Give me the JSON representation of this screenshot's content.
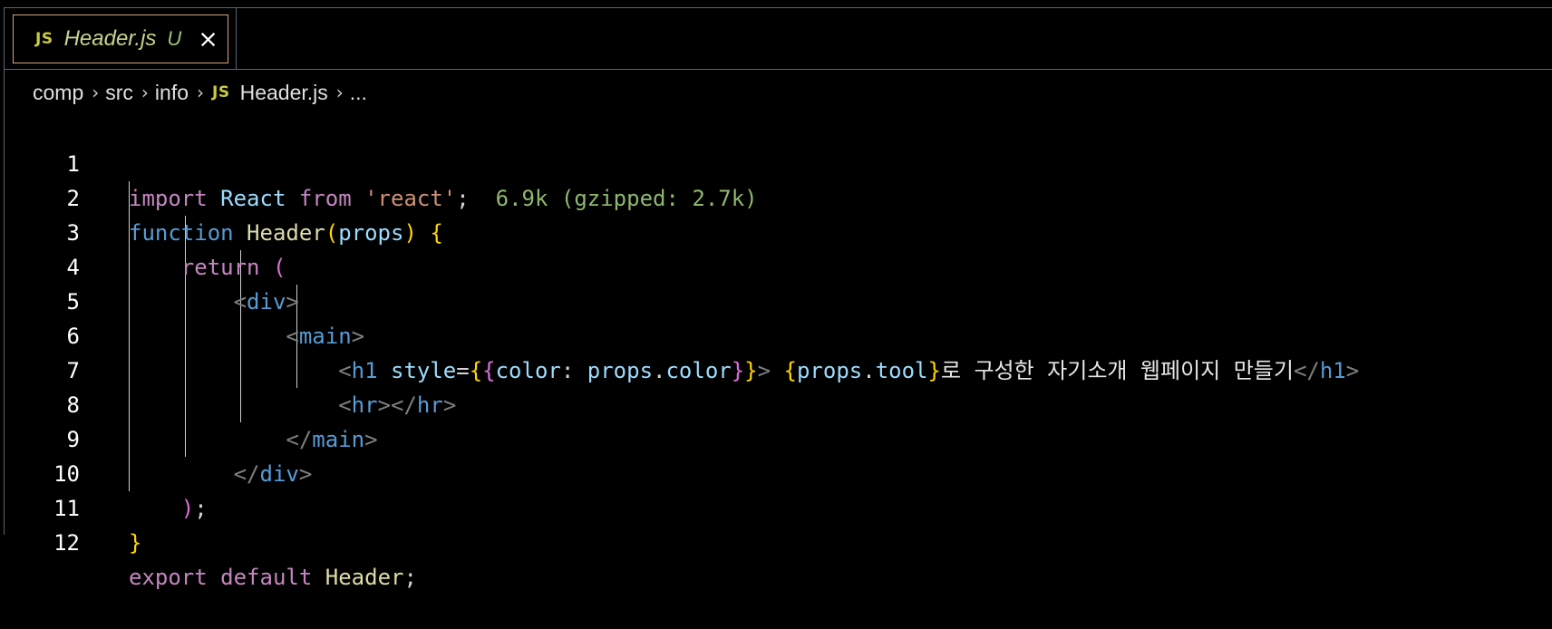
{
  "tab": {
    "icon": "JS",
    "filename": "Header.js",
    "status": "U",
    "close_icon": "×"
  },
  "breadcrumb": {
    "items": [
      "comp",
      "src",
      "info",
      "Header.js",
      "..."
    ],
    "file_icon": "JS"
  },
  "editor": {
    "lines": [
      {
        "number": "1",
        "text": "import React from 'react';",
        "hint": "6.9k (gzipped: 2.7k)"
      },
      {
        "number": "2",
        "text": "function Header(props) {"
      },
      {
        "number": "3",
        "text": "return ("
      },
      {
        "number": "4",
        "text": "<div>"
      },
      {
        "number": "5",
        "text": "<main>"
      },
      {
        "number": "6",
        "text": "<h1 style={{color: props.color}}> {props.tool}로 구성한 자기소개 웹페이지 만들기</h1>"
      },
      {
        "number": "7",
        "text": "<hr></hr>"
      },
      {
        "number": "8",
        "text": "</main>"
      },
      {
        "number": "9",
        "text": "</div>"
      },
      {
        "number": "10",
        "text": ");"
      },
      {
        "number": "11",
        "text": "}"
      },
      {
        "number": "12",
        "text": "export default Header;"
      }
    ]
  },
  "colors": {
    "background": "#000000",
    "tab_border": "#d7a27c",
    "keyword": "#c586c0",
    "storage": "#569cd6",
    "string": "#ce9178",
    "type": "#4ec9b0",
    "function": "#dcdcaa",
    "variable": "#9cdcfe",
    "hint": "#8fb86f"
  }
}
